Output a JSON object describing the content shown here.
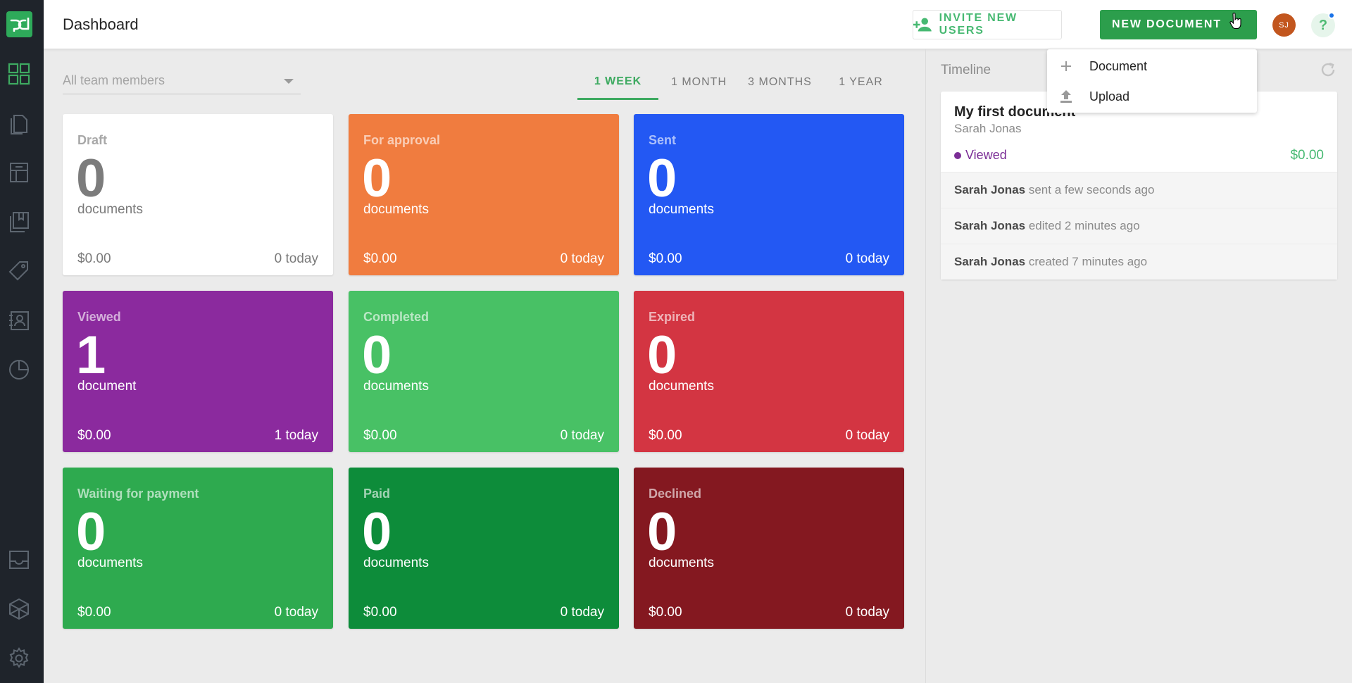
{
  "header": {
    "title": "Dashboard",
    "invite_label": "INVITE NEW USERS",
    "new_document_label": "NEW DOCUMENT",
    "avatar_initials": "SJ",
    "help_label": "?"
  },
  "filters": {
    "team_placeholder": "All team members",
    "periods": [
      "1 WEEK",
      "1 MONTH",
      "3 MONTHS",
      "1 YEAR"
    ],
    "active_period": "1 WEEK"
  },
  "cards": [
    {
      "label": "Draft",
      "count": "0",
      "unit": "documents",
      "amount": "$0.00",
      "today": "0 today",
      "color": "#ffffff"
    },
    {
      "label": "For approval",
      "count": "0",
      "unit": "documents",
      "amount": "$0.00",
      "today": "0 today",
      "color": "#f07c3f"
    },
    {
      "label": "Sent",
      "count": "0",
      "unit": "documents",
      "amount": "$0.00",
      "today": "0 today",
      "color": "#2358f3"
    },
    {
      "label": "Viewed",
      "count": "1",
      "unit": "document",
      "amount": "$0.00",
      "today": "1 today",
      "color": "#8b2a9e"
    },
    {
      "label": "Completed",
      "count": "0",
      "unit": "documents",
      "amount": "$0.00",
      "today": "0 today",
      "color": "#48c165"
    },
    {
      "label": "Expired",
      "count": "0",
      "unit": "documents",
      "amount": "$0.00",
      "today": "0 today",
      "color": "#d33542"
    },
    {
      "label": "Waiting for payment",
      "count": "0",
      "unit": "documents",
      "amount": "$0.00",
      "today": "0 today",
      "color": "#2eaa4f"
    },
    {
      "label": "Paid",
      "count": "0",
      "unit": "documents",
      "amount": "$0.00",
      "today": "0 today",
      "color": "#0d8c3a"
    },
    {
      "label": "Declined",
      "count": "0",
      "unit": "documents",
      "amount": "$0.00",
      "today": "0 today",
      "color": "#841820"
    }
  ],
  "timeline": {
    "title": "Timeline",
    "document": {
      "name": "My first document",
      "owner": "Sarah Jonas",
      "status": "Viewed",
      "amount": "$0.00"
    },
    "events": [
      {
        "user": "Sarah Jonas",
        "action": "sent a few seconds ago"
      },
      {
        "user": "Sarah Jonas",
        "action": "edited 2 minutes ago"
      },
      {
        "user": "Sarah Jonas",
        "action": "created 7 minutes ago"
      }
    ]
  },
  "new_document_menu": {
    "items": [
      {
        "label": "Document",
        "icon": "plus-icon"
      },
      {
        "label": "Upload",
        "icon": "upload-icon"
      }
    ]
  },
  "sidebar": {
    "icons": [
      "dashboard-icon",
      "documents-icon",
      "templates-icon",
      "content-library-icon",
      "catalog-icon",
      "contacts-icon",
      "reports-icon",
      "inbox-icon",
      "integrations-icon",
      "settings-icon"
    ]
  },
  "colors": {
    "brand_green": "#2c9e4c",
    "sidebar_bg": "#1f242b",
    "accent_green": "#3eaa61"
  }
}
